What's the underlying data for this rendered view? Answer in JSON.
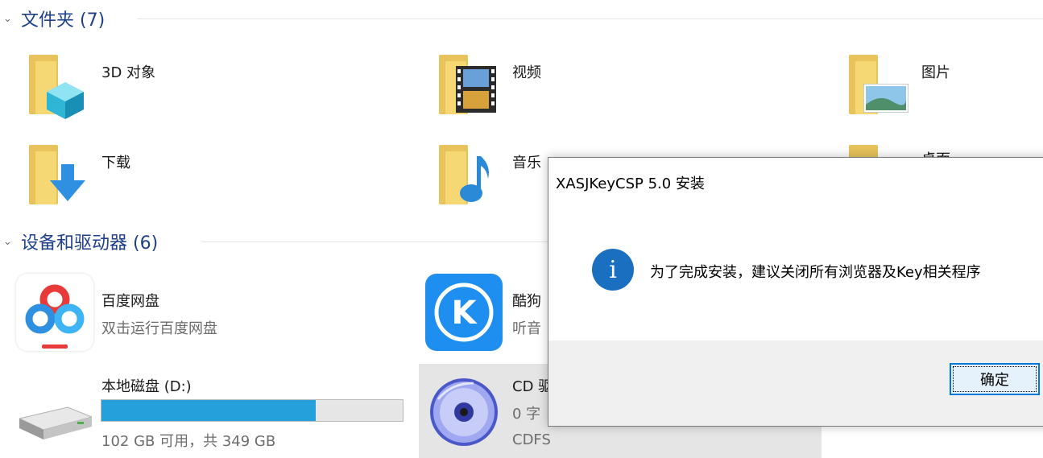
{
  "sections": {
    "folders": "文件夹 (7)",
    "devices": "设备和驱动器 (6)"
  },
  "folders": [
    {
      "label": "3D 对象",
      "icon": "3d-objects-folder-icon"
    },
    {
      "label": "视频",
      "icon": "videos-folder-icon"
    },
    {
      "label": "图片",
      "icon": "pictures-folder-icon"
    },
    {
      "label": "下载",
      "icon": "downloads-folder-icon"
    },
    {
      "label": "音乐",
      "icon": "music-folder-icon"
    },
    {
      "label": "桌面",
      "icon": "desktop-folder-icon"
    }
  ],
  "devices": [
    {
      "name": "百度网盘",
      "detail": "双击运行百度网盘",
      "icon": "baidu-netdisk-icon"
    },
    {
      "name": "酷狗",
      "detail": "听音",
      "icon": "kugou-icon"
    },
    {
      "name": "本地磁盘 (D:)",
      "detail": "102 GB 可用，共 349 GB",
      "used_fraction": 0.71,
      "icon": "hard-drive-icon"
    },
    {
      "name": "CD 驱",
      "detail": "0 字",
      "fs": "CDFS",
      "icon": "cd-drive-icon"
    }
  ],
  "dialog": {
    "title": "XASJKeyCSP 5.0 安装",
    "message": "为了完成安装，建议关闭所有浏览器及Key相关程序",
    "ok_label": "确定"
  },
  "colors": {
    "accent": "#0078d7",
    "header": "#1e3f8a",
    "drive_fill": "#26a0da"
  }
}
